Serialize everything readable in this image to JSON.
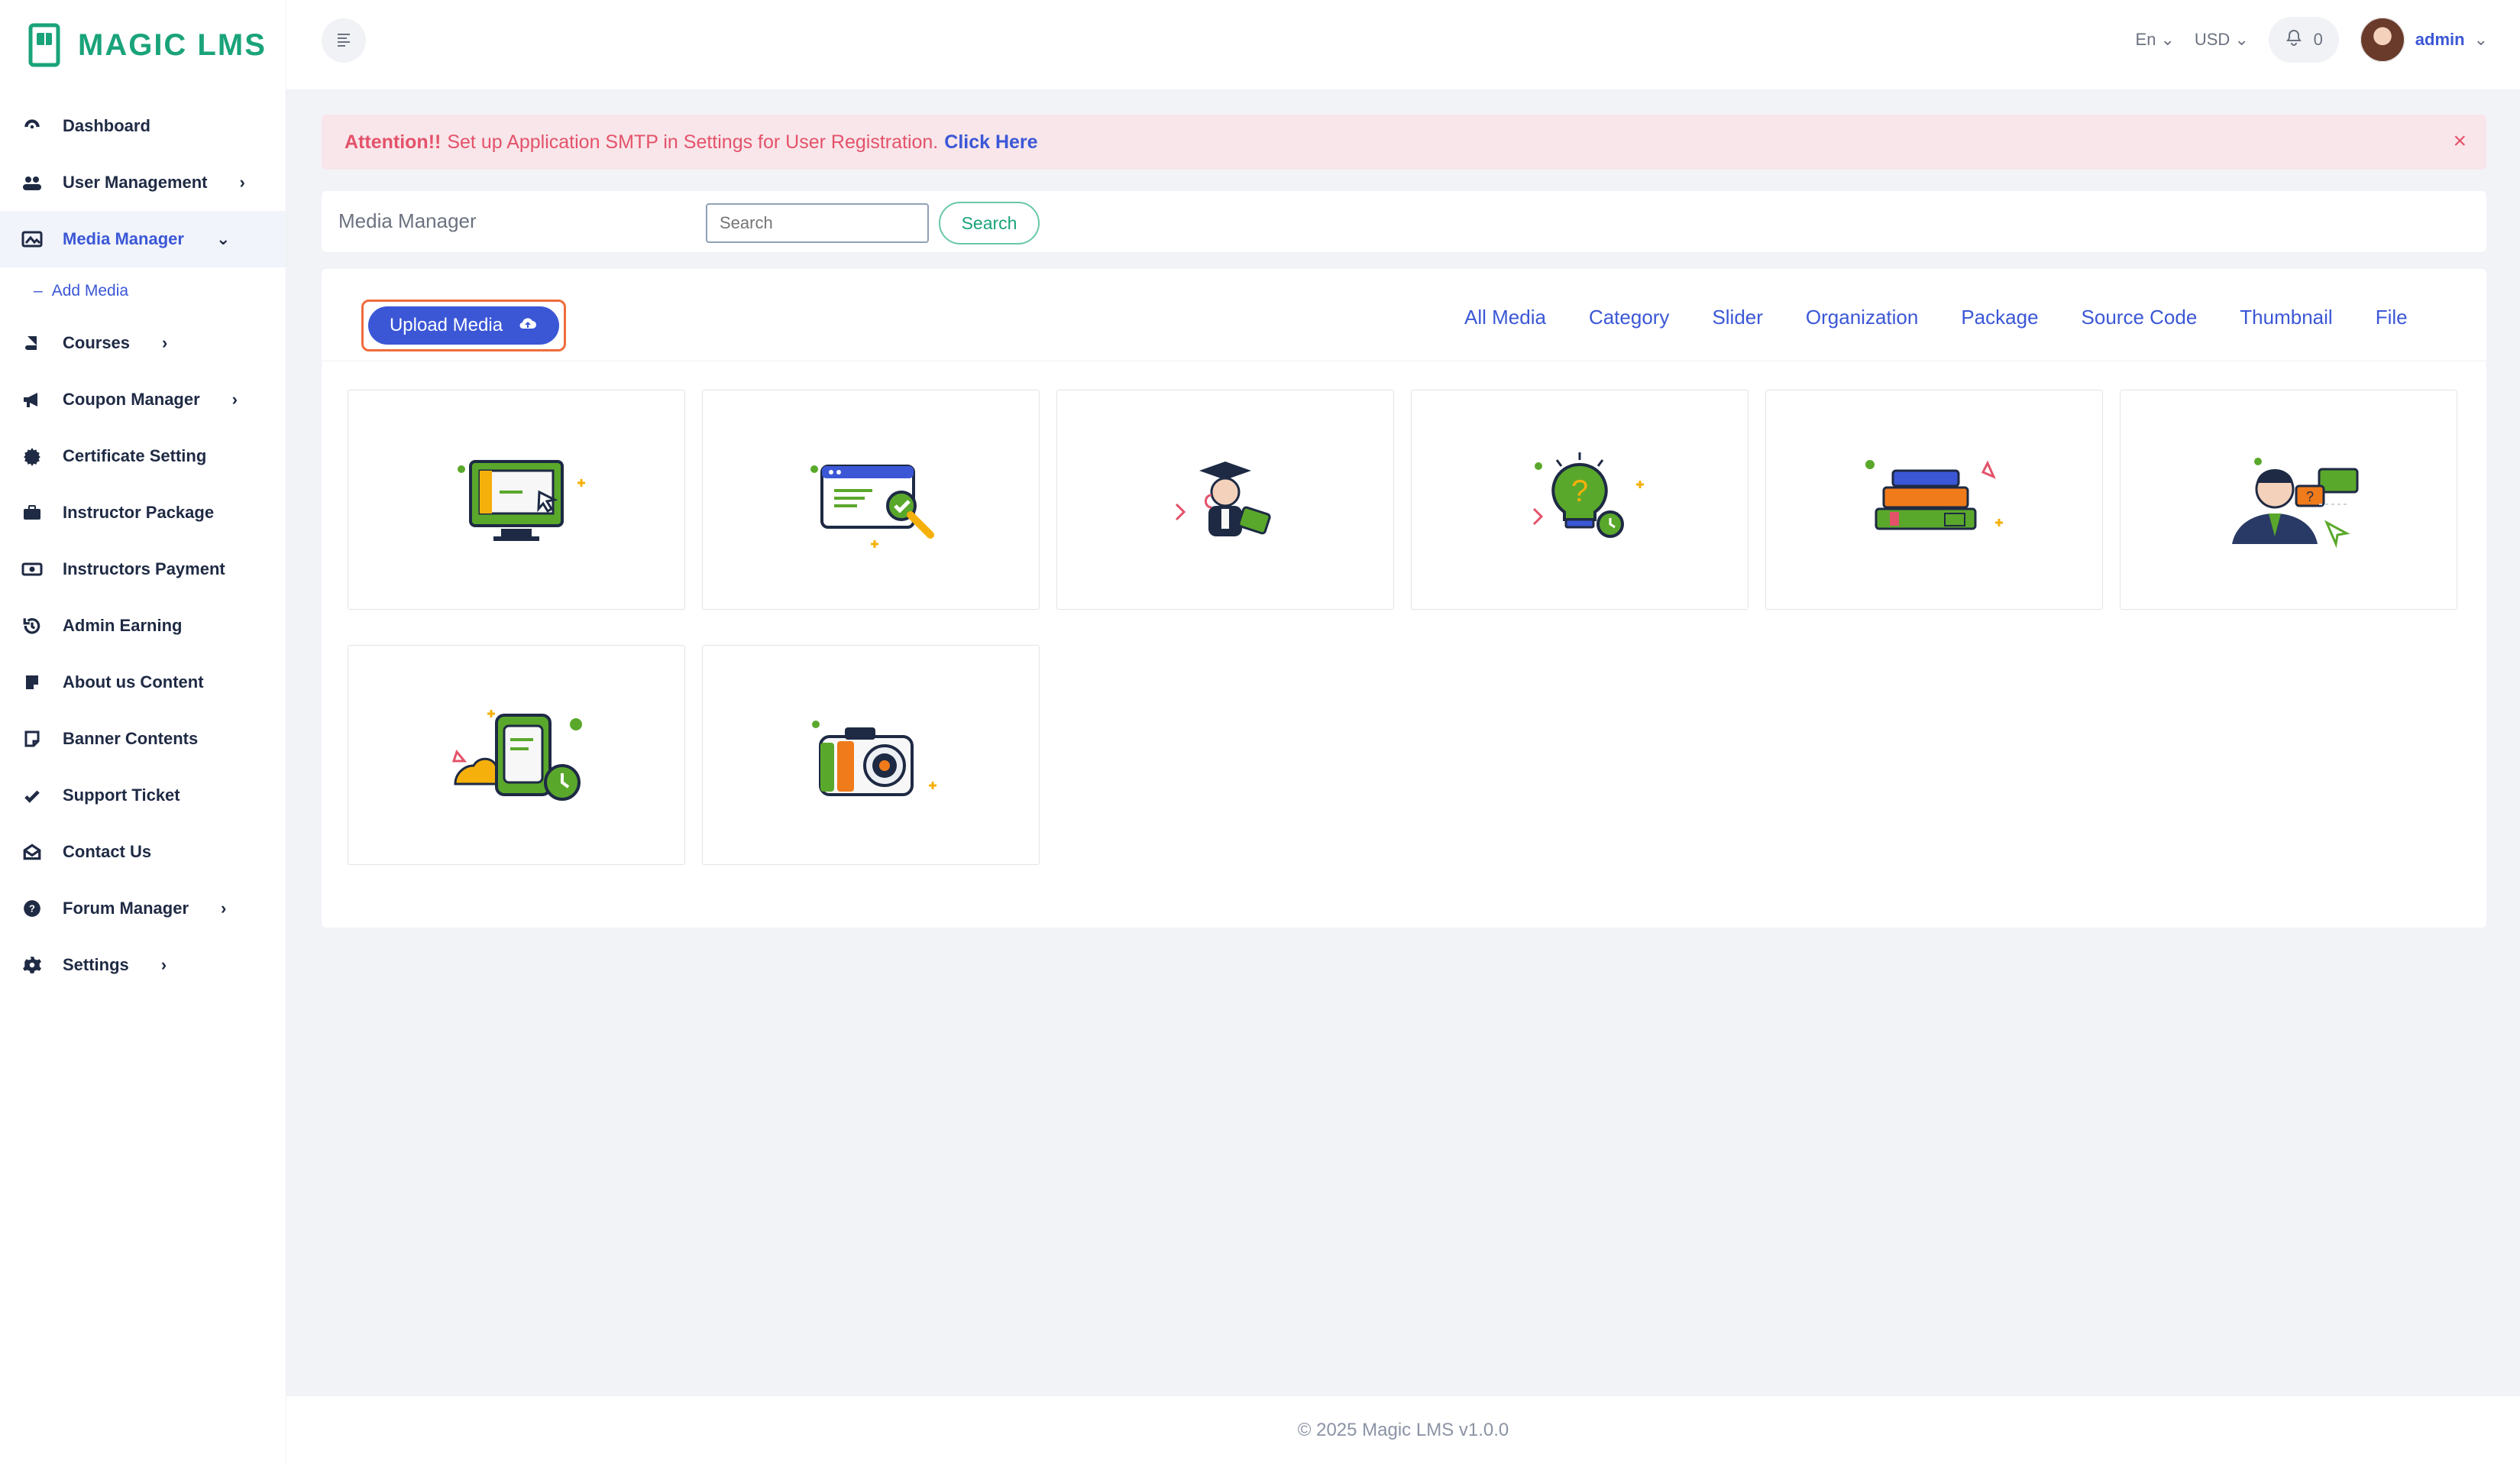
{
  "app": {
    "brand": "MAGIC LMS",
    "brand_color": "#1aa37a",
    "accent_color": "#3b57d6"
  },
  "sidebar": {
    "items": [
      {
        "label": "Dashboard",
        "icon": "dashboard-icon",
        "expandable": false
      },
      {
        "label": "User Management",
        "icon": "users-icon",
        "expandable": true
      },
      {
        "label": "Media Manager",
        "icon": "image-icon",
        "expandable": true,
        "active": true
      },
      {
        "label": "Add Media",
        "icon": "",
        "sub": true
      },
      {
        "label": "Courses",
        "icon": "book-icon",
        "expandable": true
      },
      {
        "label": "Coupon Manager",
        "icon": "megaphone-icon",
        "expandable": true
      },
      {
        "label": "Certificate Setting",
        "icon": "certificate-icon",
        "expandable": false
      },
      {
        "label": "Instructor Package",
        "icon": "briefcase-icon",
        "expandable": false
      },
      {
        "label": "Instructors Payment",
        "icon": "money-icon",
        "expandable": false
      },
      {
        "label": "Admin Earning",
        "icon": "history-icon",
        "expandable": false
      },
      {
        "label": "About us Content",
        "icon": "note-icon",
        "expandable": false
      },
      {
        "label": "Banner Contents",
        "icon": "sticky-note-icon",
        "expandable": false
      },
      {
        "label": "Support Ticket",
        "icon": "ticket-icon",
        "expandable": false
      },
      {
        "label": "Contact Us",
        "icon": "envelope-open-icon",
        "expandable": false
      },
      {
        "label": "Forum Manager",
        "icon": "question-circle-icon",
        "expandable": true
      },
      {
        "label": "Settings",
        "icon": "gear-icon",
        "expandable": true
      }
    ]
  },
  "topbar": {
    "language": "En",
    "currency": "USD",
    "notifications_count": "0",
    "user": "admin"
  },
  "alert": {
    "strong": "Attention!!",
    "message": "Set up Application SMTP in Settings for User Registration.",
    "link": "Click Here",
    "close": "×"
  },
  "search": {
    "title": "Media Manager",
    "placeholder": "Search",
    "button": "Search"
  },
  "media": {
    "upload_label": "Upload Media",
    "tabs": [
      "All Media",
      "Category",
      "Slider",
      "Organization",
      "Package",
      "Source Code",
      "Thumbnail",
      "File"
    ],
    "items": [
      {
        "illustration": "monitor-illustration"
      },
      {
        "illustration": "browser-check-illustration"
      },
      {
        "illustration": "graduate-illustration"
      },
      {
        "illustration": "idea-bulb-illustration"
      },
      {
        "illustration": "books-illustration"
      },
      {
        "illustration": "instructor-chat-illustration"
      },
      {
        "illustration": "tablet-clock-illustration"
      },
      {
        "illustration": "camera-illustration"
      }
    ]
  },
  "footer": {
    "text": "© 2025 Magic LMS v1.0.0"
  }
}
